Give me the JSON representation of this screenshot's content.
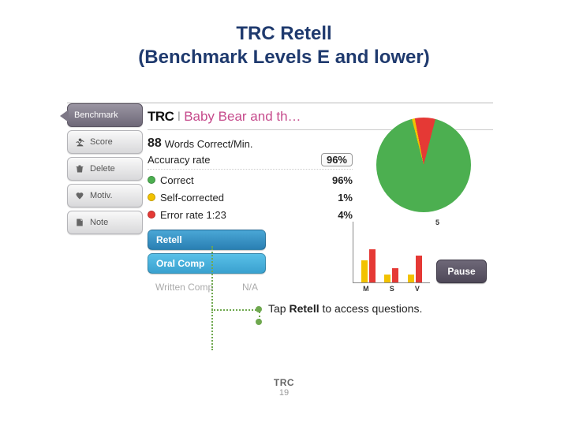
{
  "title_line1": "TRC Retell",
  "title_line2": "(Benchmark Levels E and lower)",
  "header": {
    "trc": "TRC",
    "separator": "I",
    "book_title": "Baby Bear and th…"
  },
  "wcpm": {
    "value": "88",
    "label": "Words Correct/Min."
  },
  "accuracy": {
    "label": "Accuracy rate",
    "value": "96%"
  },
  "legend": {
    "correct": {
      "label": "Correct",
      "value": "96%"
    },
    "self_corrected": {
      "label": "Self-corrected",
      "value": "1%"
    },
    "error": {
      "label": "Error rate 1:23",
      "value": "4%"
    }
  },
  "left_buttons": {
    "benchmark": "Benchmark",
    "score": "Score",
    "delete": "Delete",
    "motiv": "Motiv.",
    "note": "Note"
  },
  "modes": {
    "retell": "Retell",
    "oral": "Oral Comp",
    "written": "Written Comp",
    "written_na": "N/A"
  },
  "barchart": {
    "max_label": "5",
    "labels": [
      "M",
      "S",
      "V"
    ]
  },
  "pause": "Pause",
  "callout": {
    "pre": "Tap ",
    "bold": "Retell",
    "post": " to access questions."
  },
  "footer": {
    "label": "TRC",
    "page": "19"
  },
  "chart_data": [
    {
      "type": "pie",
      "title": "Accuracy breakdown",
      "series": [
        {
          "name": "Correct",
          "value": 96,
          "color": "#4caf50"
        },
        {
          "name": "Error",
          "value": 4,
          "color": "#e53935"
        },
        {
          "name": "Self-corrected",
          "value": 1,
          "color": "#f2c200"
        }
      ]
    },
    {
      "type": "bar",
      "title": "Error analysis",
      "ylim": [
        0,
        5
      ],
      "categories": [
        "M",
        "S",
        "V"
      ],
      "series": [
        {
          "name": "yellow",
          "values": [
            2,
            1,
            1
          ],
          "color": "#f2c200"
        },
        {
          "name": "red",
          "values": [
            3,
            2,
            3
          ],
          "color": "#e53935"
        }
      ]
    }
  ]
}
